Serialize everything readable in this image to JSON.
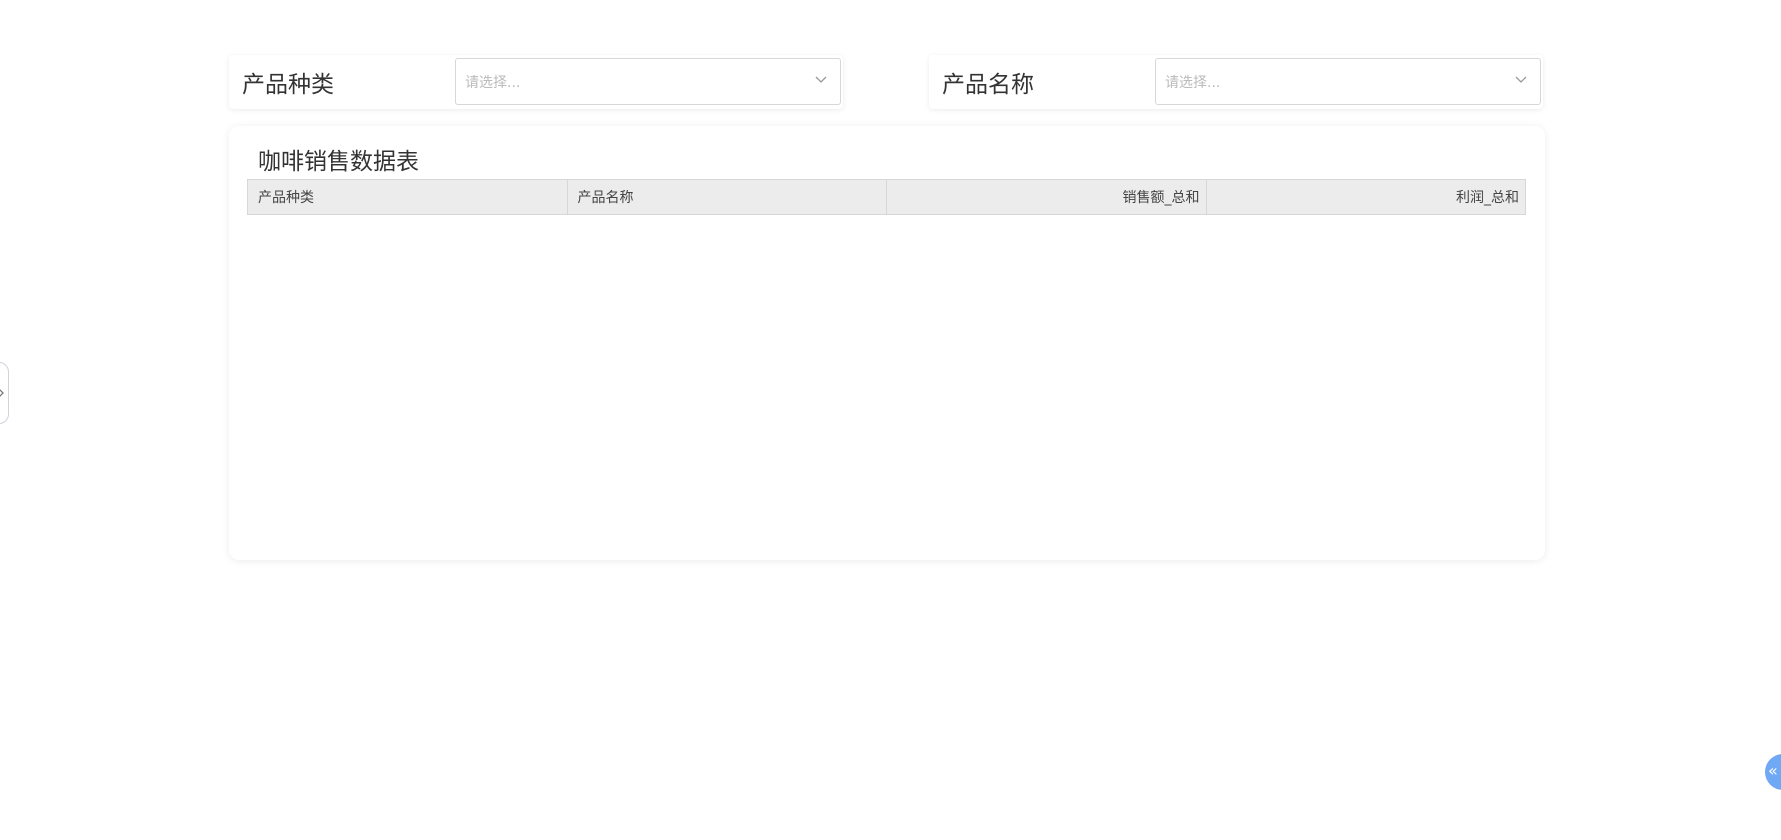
{
  "filters": {
    "category": {
      "label": "产品种类",
      "placeholder": "请选择..."
    },
    "product_name": {
      "label": "产品名称",
      "placeholder": "请选择..."
    }
  },
  "table": {
    "title": "咖啡销售数据表",
    "columns": [
      "产品种类",
      "产品名称",
      "销售额_总和",
      "利润_总和"
    ],
    "rows": []
  },
  "side_tab": {
    "icon": "chevron-right-icon"
  },
  "float_button": {
    "icon": "double-chevron-left-icon",
    "glyph": "«",
    "color": "#6fa8f5"
  }
}
